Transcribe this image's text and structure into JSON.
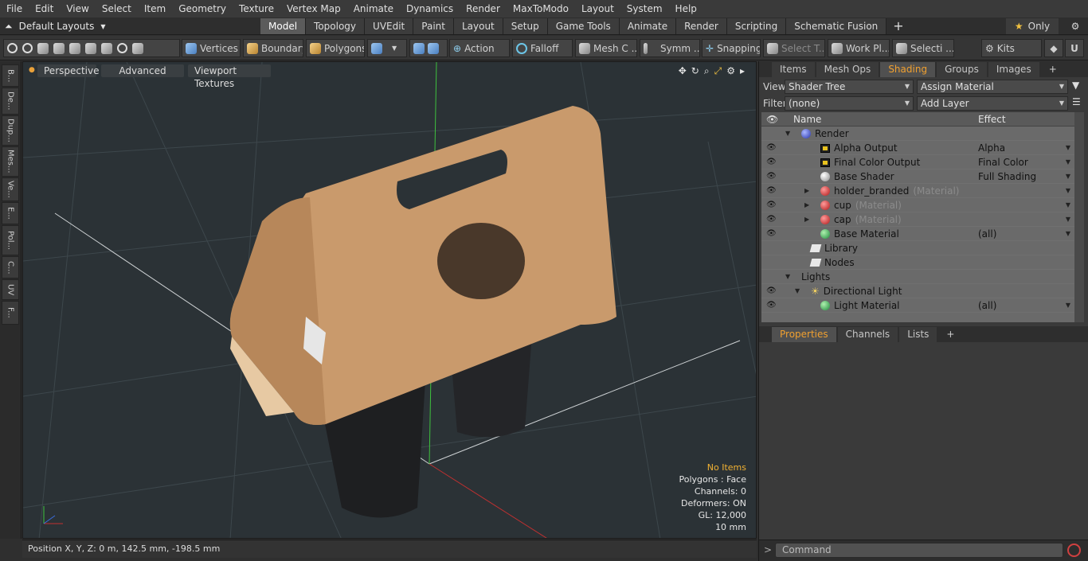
{
  "menu": [
    "File",
    "Edit",
    "View",
    "Select",
    "Item",
    "Geometry",
    "Texture",
    "Vertex Map",
    "Animate",
    "Dynamics",
    "Render",
    "MaxToModo",
    "Layout",
    "System",
    "Help"
  ],
  "layout_selector": "Default Layouts",
  "mode_tabs": [
    "Model",
    "Topology",
    "UVEdit",
    "Paint",
    "Layout",
    "Setup",
    "Game Tools",
    "Animate",
    "Render",
    "Scripting",
    "Schematic Fusion"
  ],
  "active_mode_tab": "Model",
  "only_label": "Only",
  "toolbar": {
    "vertices": "Vertices",
    "boundary": "Boundary",
    "polygons": "Polygons",
    "action": "Action",
    "falloff": "Falloff",
    "mesh": "Mesh C ...",
    "symmetry": "Symm ...",
    "snapping": "Snapping",
    "select_t": "Select T...",
    "work_plane": "Work Pl...",
    "selection": "Selecti ...",
    "kits": "Kits"
  },
  "left_tabs": [
    "B...",
    "De...",
    "Dup...",
    "Mes...",
    "Ve...",
    "E...",
    "Pol...",
    "C...",
    "UV",
    "F..."
  ],
  "viewport": {
    "view_mode": "Perspective",
    "shading": "Advanced",
    "textures": "Viewport Textures"
  },
  "viewport_info": {
    "selection": "No Items",
    "polygons": "Polygons : Face",
    "channels": "Channels: 0",
    "deformers": "Deformers: ON",
    "gl": "GL: 12,000",
    "unit": "10 mm"
  },
  "status": "Position X, Y, Z:   0 m, 142.5 mm, -198.5 mm",
  "panel_tabs": [
    "Items",
    "Mesh Ops",
    "Shading",
    "Groups",
    "Images"
  ],
  "active_panel_tab": "Shading",
  "view_label": "View",
  "view_value": "Shader Tree",
  "assign_material": "Assign Material",
  "filter_label": "Filter",
  "filter_value": "(none)",
  "add_layer": "Add Layer",
  "tree_headers": {
    "name": "Name",
    "effect": "Effect"
  },
  "tree_rows": [
    {
      "name": "Render",
      "sub": "",
      "effect": "",
      "icon": "b-blue"
    },
    {
      "name": "Alpha Output",
      "sub": "",
      "effect": "Alpha",
      "icon": "img"
    },
    {
      "name": "Final Color Output",
      "sub": "",
      "effect": "Final Color",
      "icon": "img"
    },
    {
      "name": "Base Shader",
      "sub": "",
      "effect": "Full Shading",
      "icon": "b-white"
    },
    {
      "name": "holder_branded",
      "sub": "(Material)",
      "effect": "",
      "icon": "b-red"
    },
    {
      "name": "cup",
      "sub": "(Material)",
      "effect": "",
      "icon": "b-red"
    },
    {
      "name": "cap",
      "sub": "(Material)",
      "effect": "",
      "icon": "b-red"
    },
    {
      "name": "Base Material",
      "sub": "",
      "effect": "(all)",
      "icon": "b-green"
    },
    {
      "name": "Library",
      "sub": "",
      "effect": "",
      "icon": "folder"
    },
    {
      "name": "Nodes",
      "sub": "",
      "effect": "",
      "icon": "folder"
    },
    {
      "name": "Lights",
      "sub": "",
      "effect": "",
      "icon": "none"
    },
    {
      "name": "Directional Light",
      "sub": "",
      "effect": "",
      "icon": "light"
    },
    {
      "name": "Light Material",
      "sub": "",
      "effect": "(all)",
      "icon": "b-green"
    }
  ],
  "prop_tabs": [
    "Properties",
    "Channels",
    "Lists"
  ],
  "command_placeholder": "Command"
}
